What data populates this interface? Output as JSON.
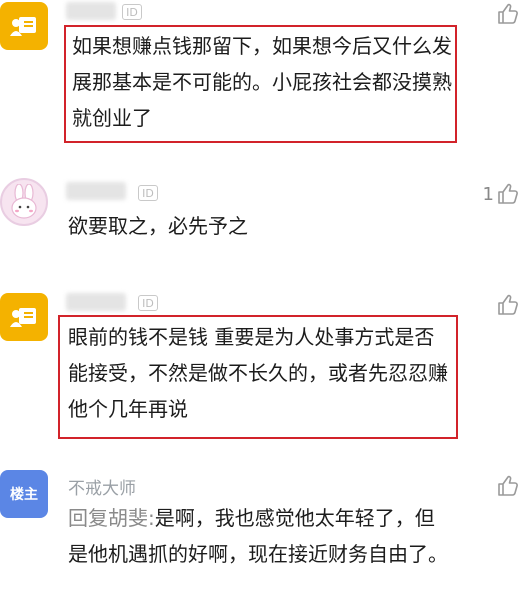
{
  "comments": [
    {
      "id_label": "ID",
      "text": "如果想赚点钱那留下，如果想今后又什么发展那基本是不可能的。小屁孩社会都没摸熟就创业了",
      "like_count": ""
    },
    {
      "id_label": "ID",
      "text": "欲要取之，必先予之",
      "like_count": "1"
    },
    {
      "id_label": "ID",
      "text": "眼前的钱不是钱 重要是为人处事方式是否能接受，不然是做不长久的，或者先忍忍赚他个几年再说",
      "like_count": ""
    },
    {
      "avatar_label": "楼主",
      "author": "不戒大师",
      "reply_prefix": "回复胡斐:",
      "text": "是啊，我也感觉他太年轻了，但是他机遇抓的好啊，现在接近财务自由了。",
      "like_count": ""
    }
  ],
  "colors": {
    "highlight_border": "#d2232a",
    "avatar_yellow": "#f4b200",
    "avatar_blue": "#5b86e5"
  },
  "icons": {
    "like": "thumb-up-icon",
    "avatar_default": "user-card-icon",
    "avatar_rabbit": "rabbit-icon"
  }
}
